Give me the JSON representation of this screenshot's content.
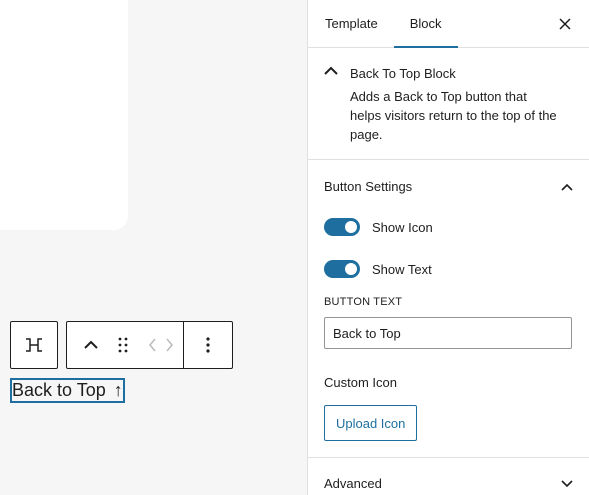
{
  "canvas": {
    "block_text": "Back to Top",
    "block_arrow": "↑"
  },
  "toolbar": {
    "transform_icon": "block-type-icon",
    "move_up_icon": "chevron-up-icon",
    "drag_icon": "drag-handle-icon",
    "code_icon": "code-icon",
    "more_icon": "more-vertical-icon"
  },
  "sidebar": {
    "tabs": [
      {
        "label": "Template",
        "active": false
      },
      {
        "label": "Block",
        "active": true
      }
    ],
    "close_icon": "close-icon",
    "block_card": {
      "title": "Back To Top Block",
      "description": "Adds a Back to Top button that helps visitors return to the top of the page."
    },
    "button_settings": {
      "title": "Button Settings",
      "show_icon_label": "Show Icon",
      "show_icon_on": true,
      "show_text_label": "Show Text",
      "show_text_on": true,
      "button_text_label": "BUTTON TEXT",
      "button_text_value": "Back to Top",
      "custom_icon_label": "Custom Icon",
      "upload_label": "Upload Icon"
    },
    "advanced": {
      "title": "Advanced"
    }
  },
  "colors": {
    "accent": "#1e6fa0",
    "canvas_bg": "#f6f6f6",
    "border": "#e0e0e0"
  }
}
